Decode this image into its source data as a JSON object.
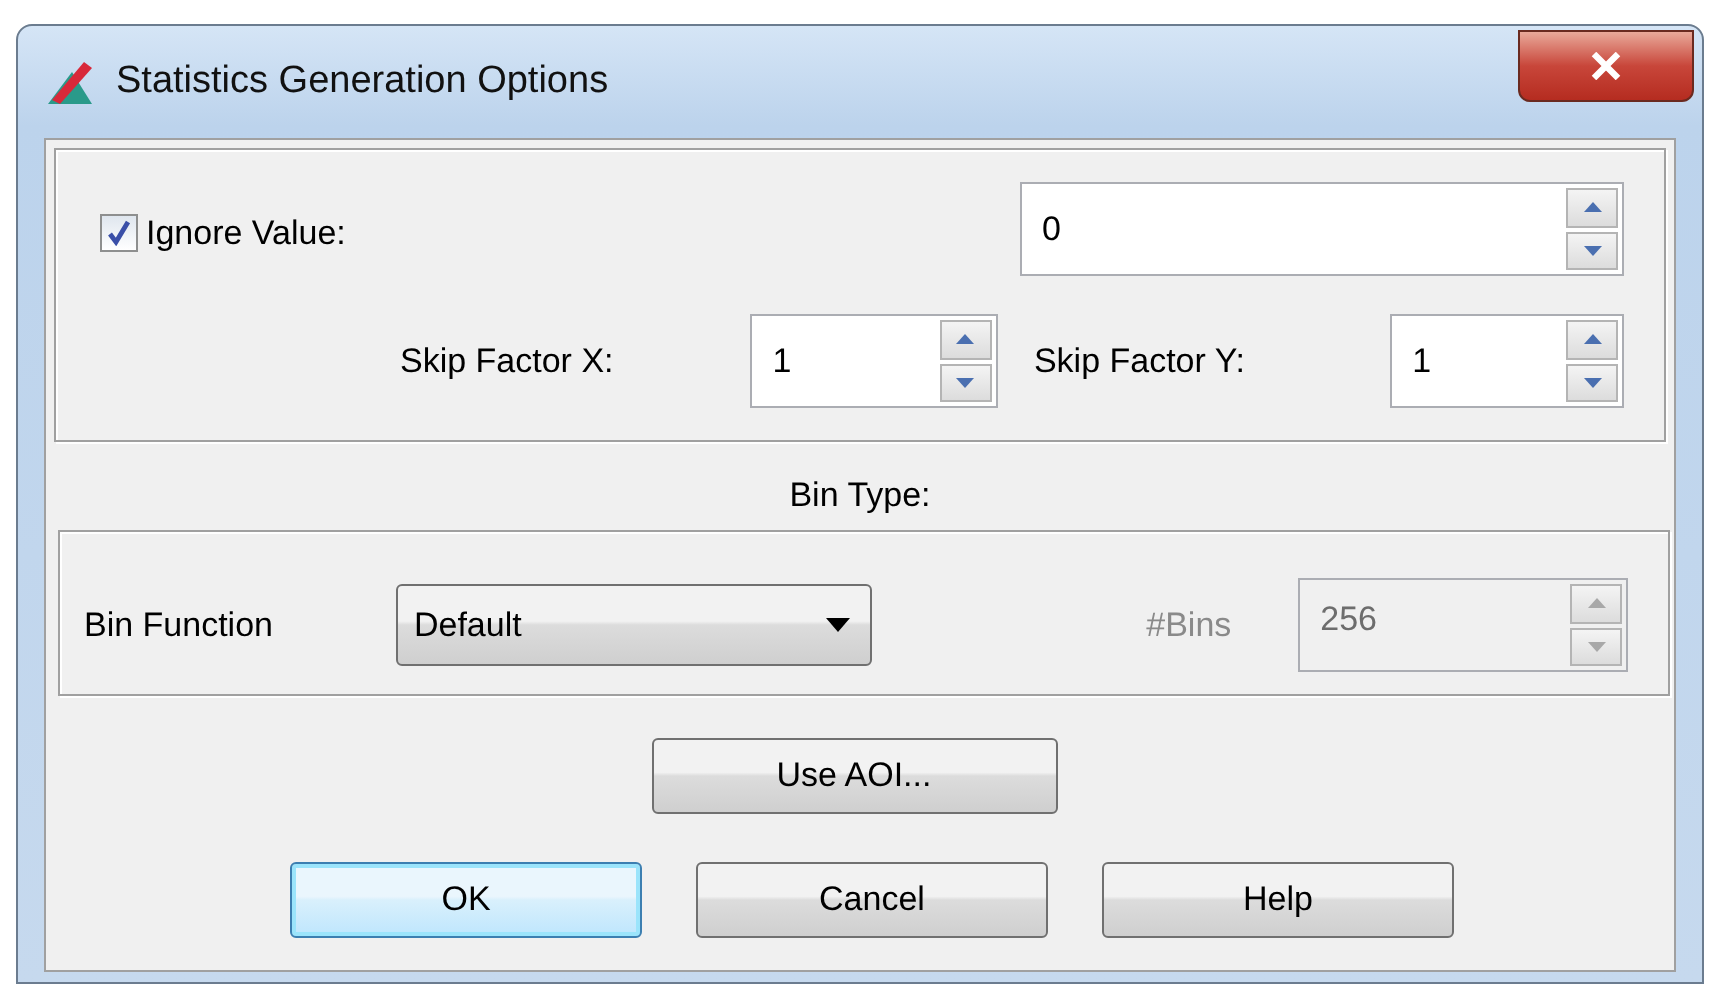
{
  "window": {
    "title": "Statistics Generation Options"
  },
  "ignore_value": {
    "label": "Ignore Value:",
    "checked": true,
    "value": "0"
  },
  "skip_factor_x": {
    "label": "Skip Factor X:",
    "value": "1"
  },
  "skip_factor_y": {
    "label": "Skip Factor Y:",
    "value": "1"
  },
  "bin_type": {
    "label": "Bin Type:"
  },
  "bin_function": {
    "label": "Bin Function",
    "value": "Default"
  },
  "bins": {
    "label": "#Bins",
    "value": "256",
    "disabled": true
  },
  "aoi_button": {
    "label": "Use AOI..."
  },
  "buttons": [
    {
      "label": "OK",
      "default": true
    },
    {
      "label": "Cancel",
      "default": false
    },
    {
      "label": "Help",
      "default": false
    }
  ]
}
